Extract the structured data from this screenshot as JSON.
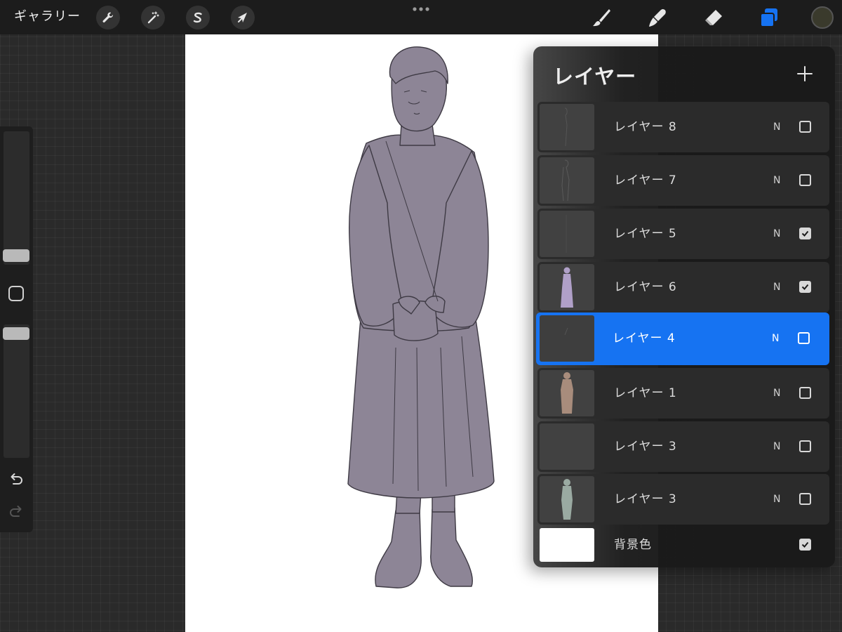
{
  "topbar": {
    "gallery_label": "ギャラリー",
    "left_tools": [
      {
        "name": "actions",
        "icon": "wrench-icon"
      },
      {
        "name": "adjustments",
        "icon": "magic-wand-icon"
      },
      {
        "name": "selection",
        "icon": "selection-s-icon"
      },
      {
        "name": "transform",
        "icon": "arrow-cursor-icon"
      }
    ],
    "right_tools": [
      {
        "name": "brush",
        "icon": "brush-icon"
      },
      {
        "name": "smudge",
        "icon": "smudge-finger-icon"
      },
      {
        "name": "eraser",
        "icon": "eraser-icon"
      },
      {
        "name": "layers",
        "icon": "layers-icon",
        "active": true
      }
    ],
    "current_color": "#3a3a2c",
    "accent": "#1673f2"
  },
  "sidebar": {
    "brush_size_icon": "slider-thumb",
    "modify_icon": "square-icon",
    "undo_icon": "undo-icon",
    "redo_icon": "redo-icon"
  },
  "layers_panel": {
    "title": "レイヤー",
    "add_icon": "plus-icon",
    "layers": [
      {
        "name": "レイヤー 8",
        "blend": "N",
        "visible": false,
        "selected": false
      },
      {
        "name": "レイヤー 7",
        "blend": "N",
        "visible": false,
        "selected": false
      },
      {
        "name": "レイヤー 5",
        "blend": "N",
        "visible": true,
        "selected": false
      },
      {
        "name": "レイヤー 6",
        "blend": "N",
        "visible": true,
        "selected": false
      },
      {
        "name": "レイヤー 4",
        "blend": "N",
        "visible": false,
        "selected": true
      },
      {
        "name": "レイヤー 1",
        "blend": "N",
        "visible": false,
        "selected": false
      },
      {
        "name": "レイヤー 3",
        "blend": "N",
        "visible": false,
        "selected": false
      },
      {
        "name": "レイヤー 3",
        "blend": "N",
        "visible": false,
        "selected": false
      }
    ],
    "background": {
      "name": "背景色",
      "visible": true,
      "color": "#ffffff"
    }
  },
  "canvas": {
    "background": "#ffffff",
    "figure_fill": "#8d8596",
    "figure_stroke": "#3e3a44"
  }
}
